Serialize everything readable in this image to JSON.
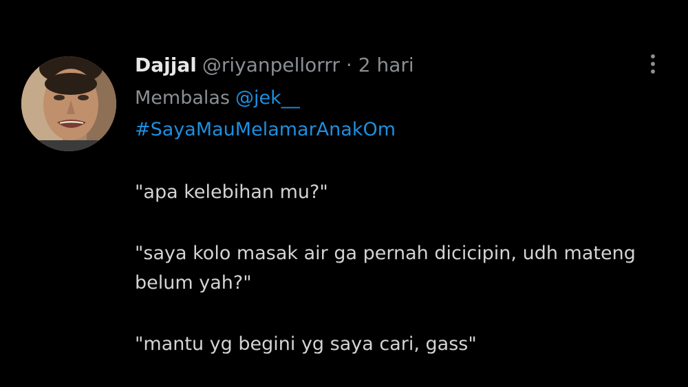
{
  "tweet": {
    "display_name": "Dajjal",
    "handle": "@riyanpellorrr",
    "separator": "·",
    "time": "2 hari",
    "reply_label": "Membalas",
    "reply_to": "@jek__",
    "hashtag": "#SayaMauMelamarAnakOm",
    "body": {
      "line1": "\"apa kelebihan mu?\"",
      "line2": "\"saya kolo masak air ga pernah dicicipin, udh mateng",
      "line3": "belum yah?\"",
      "line4": "\"mantu yg begini yg saya cari, gass\""
    }
  },
  "colors": {
    "background": "#000000",
    "text": "#d9d9d9",
    "muted": "#8b8f94",
    "link": "#1d8fe0"
  },
  "icons": {
    "more": "more-vertical-icon",
    "avatar": "avatar"
  }
}
